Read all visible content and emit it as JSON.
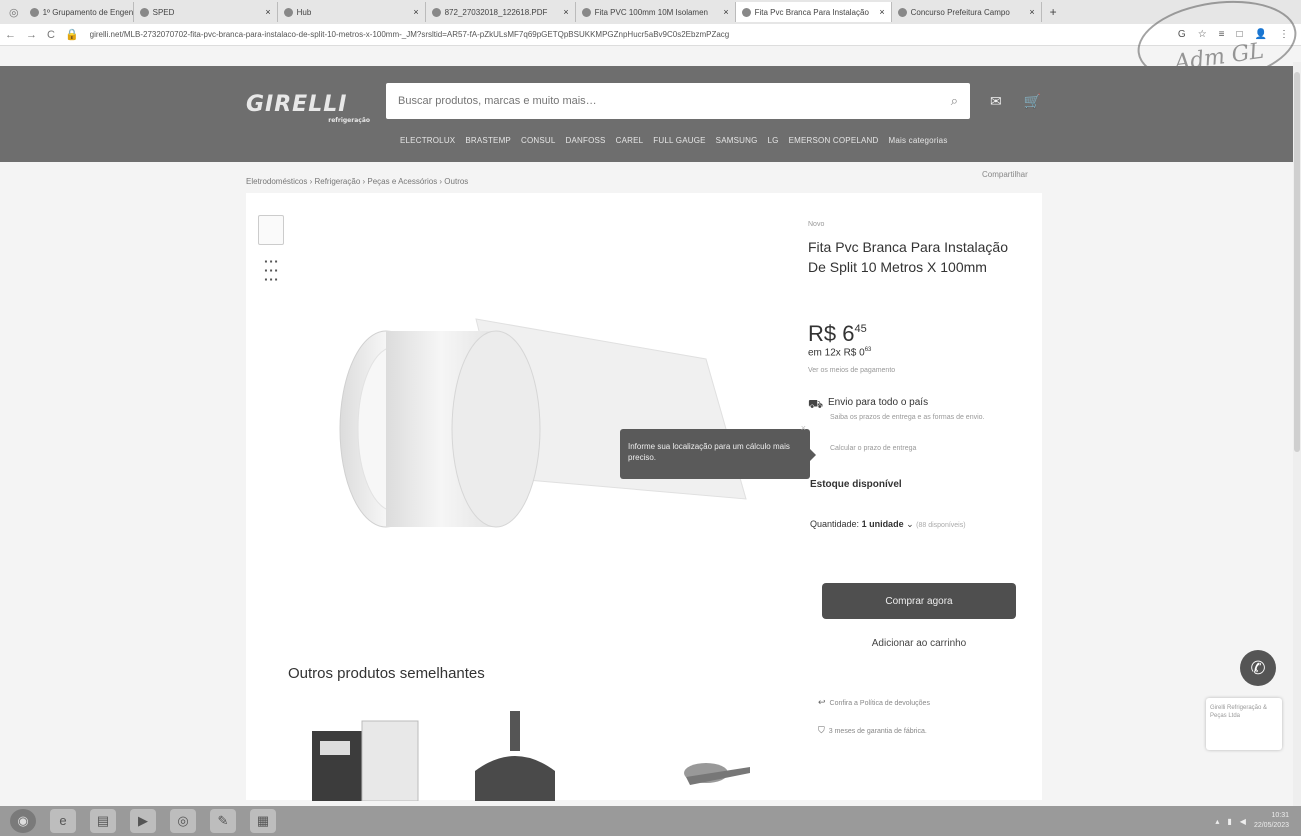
{
  "browser": {
    "tabs": [
      {
        "label": "1º Grupamento de Engenharia",
        "active": false
      },
      {
        "label": "SPED",
        "active": false
      },
      {
        "label": "Hub",
        "active": false
      },
      {
        "label": "872_27032018_122618.PDF",
        "active": false
      },
      {
        "label": "Fita PVC 100mm 10M Isolamen",
        "active": false
      },
      {
        "label": "Fita Pvc Branca Para Instalação",
        "active": true
      },
      {
        "label": "Concurso Prefeitura Campo",
        "active": false
      }
    ],
    "new_tab": "+",
    "url": "girelli.net/MLB-2732070702-fita-pvc-branca-para-instalaco-de-split-10-metros-x-100mm-_JM?srsltid=AR57-fA-pZkULsMF7q69pGETQpBSUKKMPGZnpHucr5aBv9C0s2EbzmPZacg",
    "back": "←",
    "forward": "→",
    "reload": "C",
    "tool_icons": [
      "G",
      "☆",
      "≡",
      "□",
      "👤",
      "⋮"
    ],
    "stamp_text": "Adm GL"
  },
  "header": {
    "logo": "GIRELLI",
    "logo_sub": "refrigeração",
    "search_placeholder": "Buscar produtos, marcas e muito mais…",
    "icons": [
      "mail-icon",
      "cart-icon"
    ],
    "categories": [
      "ELECTROLUX",
      "BRASTEMP",
      "CONSUL",
      "DANFOSS",
      "CAREL",
      "FULL GAUGE",
      "SAMSUNG",
      "LG",
      "EMERSON COPELAND",
      "Mais categorias"
    ]
  },
  "breadcrumb": "Eletrodomésticos › Refrigeração › Peças e Acessórios › Outros",
  "share": "Compartilhar",
  "product": {
    "condition": "Novo",
    "title": "Fita Pvc Branca Para Instalação De Split 10 Metros X 100mm",
    "price_int": "R$ 6",
    "price_cents": "45",
    "installments": "em 12x R$ 0",
    "installments_cents": "63",
    "payment_link": "Ver os meios de pagamento",
    "shipping_title": "Envio para todo o país",
    "shipping_sub": "Saiba os prazos de entrega e as formas de envio.",
    "shipping_calc": "Calcular o prazo de entrega",
    "stock": "Estoque disponível",
    "qty_label": "Quantidade:",
    "qty_value": "1 unidade",
    "qty_available": "(88 disponíveis)",
    "buy_label": "Comprar agora",
    "cart_label": "Adicionar ao carrinho",
    "return_text": "Confira a Política de devoluções",
    "warranty_text": "3 meses de garantia de fábrica."
  },
  "tooltip": {
    "text": "Informe sua localização para um cálculo mais preciso.",
    "close": "×"
  },
  "similar": {
    "title": "Outros produtos semelhantes"
  },
  "widget": {
    "text": "Girelli Refrigeração & Peças Ltda"
  },
  "taskbar": {
    "clock_time": "10:31",
    "clock_date": "22/05/2023"
  }
}
